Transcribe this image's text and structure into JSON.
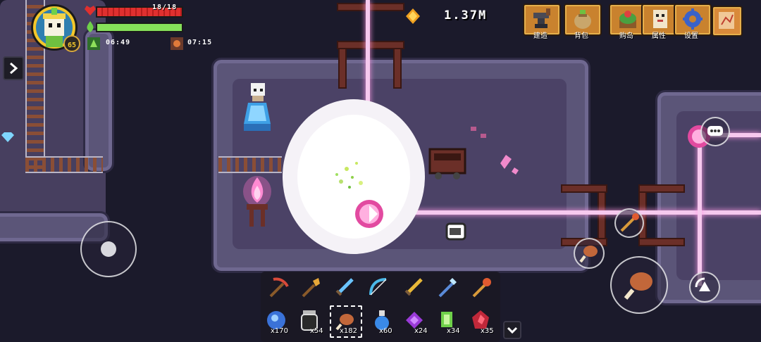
{
  "player": {
    "level": "65",
    "hp_text": "18/18",
    "hp_fraction": 1.0,
    "energy_fraction": 1.0
  },
  "timers": {
    "timer1": "06:49",
    "timer2": "07:15"
  },
  "currency": {
    "amount": "1.37M"
  },
  "menu": [
    {
      "label": "建造",
      "icon": "anvil-icon"
    },
    {
      "label": "背包",
      "icon": "bag-icon"
    },
    {
      "label": "购岛",
      "icon": "island-icon"
    },
    {
      "label": "属性",
      "icon": "character-icon"
    },
    {
      "label": "设置",
      "icon": "gear-icon"
    },
    {
      "label": "",
      "icon": "map-scroll-icon"
    }
  ],
  "hotbar": [
    {
      "name": "pickaxe",
      "icon": "pickaxe-icon"
    },
    {
      "name": "shovel",
      "icon": "shovel-icon"
    },
    {
      "name": "sword",
      "icon": "sword-icon"
    },
    {
      "name": "bow",
      "icon": "bow-icon"
    },
    {
      "name": "golden-sword",
      "icon": "golden-sword-icon"
    },
    {
      "name": "ice-staff",
      "icon": "ice-staff-icon"
    },
    {
      "name": "fire-rod",
      "icon": "fire-rod-icon"
    }
  ],
  "inventory": [
    {
      "icon": "blue-gem-icon",
      "count": "x170"
    },
    {
      "icon": "jar-icon",
      "count": "x54"
    },
    {
      "icon": "roasted-meat-icon",
      "count": "x182",
      "selected": true
    },
    {
      "icon": "blue-potion-icon",
      "count": "x60"
    },
    {
      "icon": "purple-crystal-icon",
      "count": "x24"
    },
    {
      "icon": "green-crystal-icon",
      "count": "x34"
    },
    {
      "icon": "red-ore-icon",
      "count": "x35"
    }
  ],
  "colors": {
    "hp": "#e0302f",
    "energy": "#6fd04a",
    "menu_button": "#c9822e",
    "laser": "#f6c9ee",
    "floor": "#4a4164"
  }
}
